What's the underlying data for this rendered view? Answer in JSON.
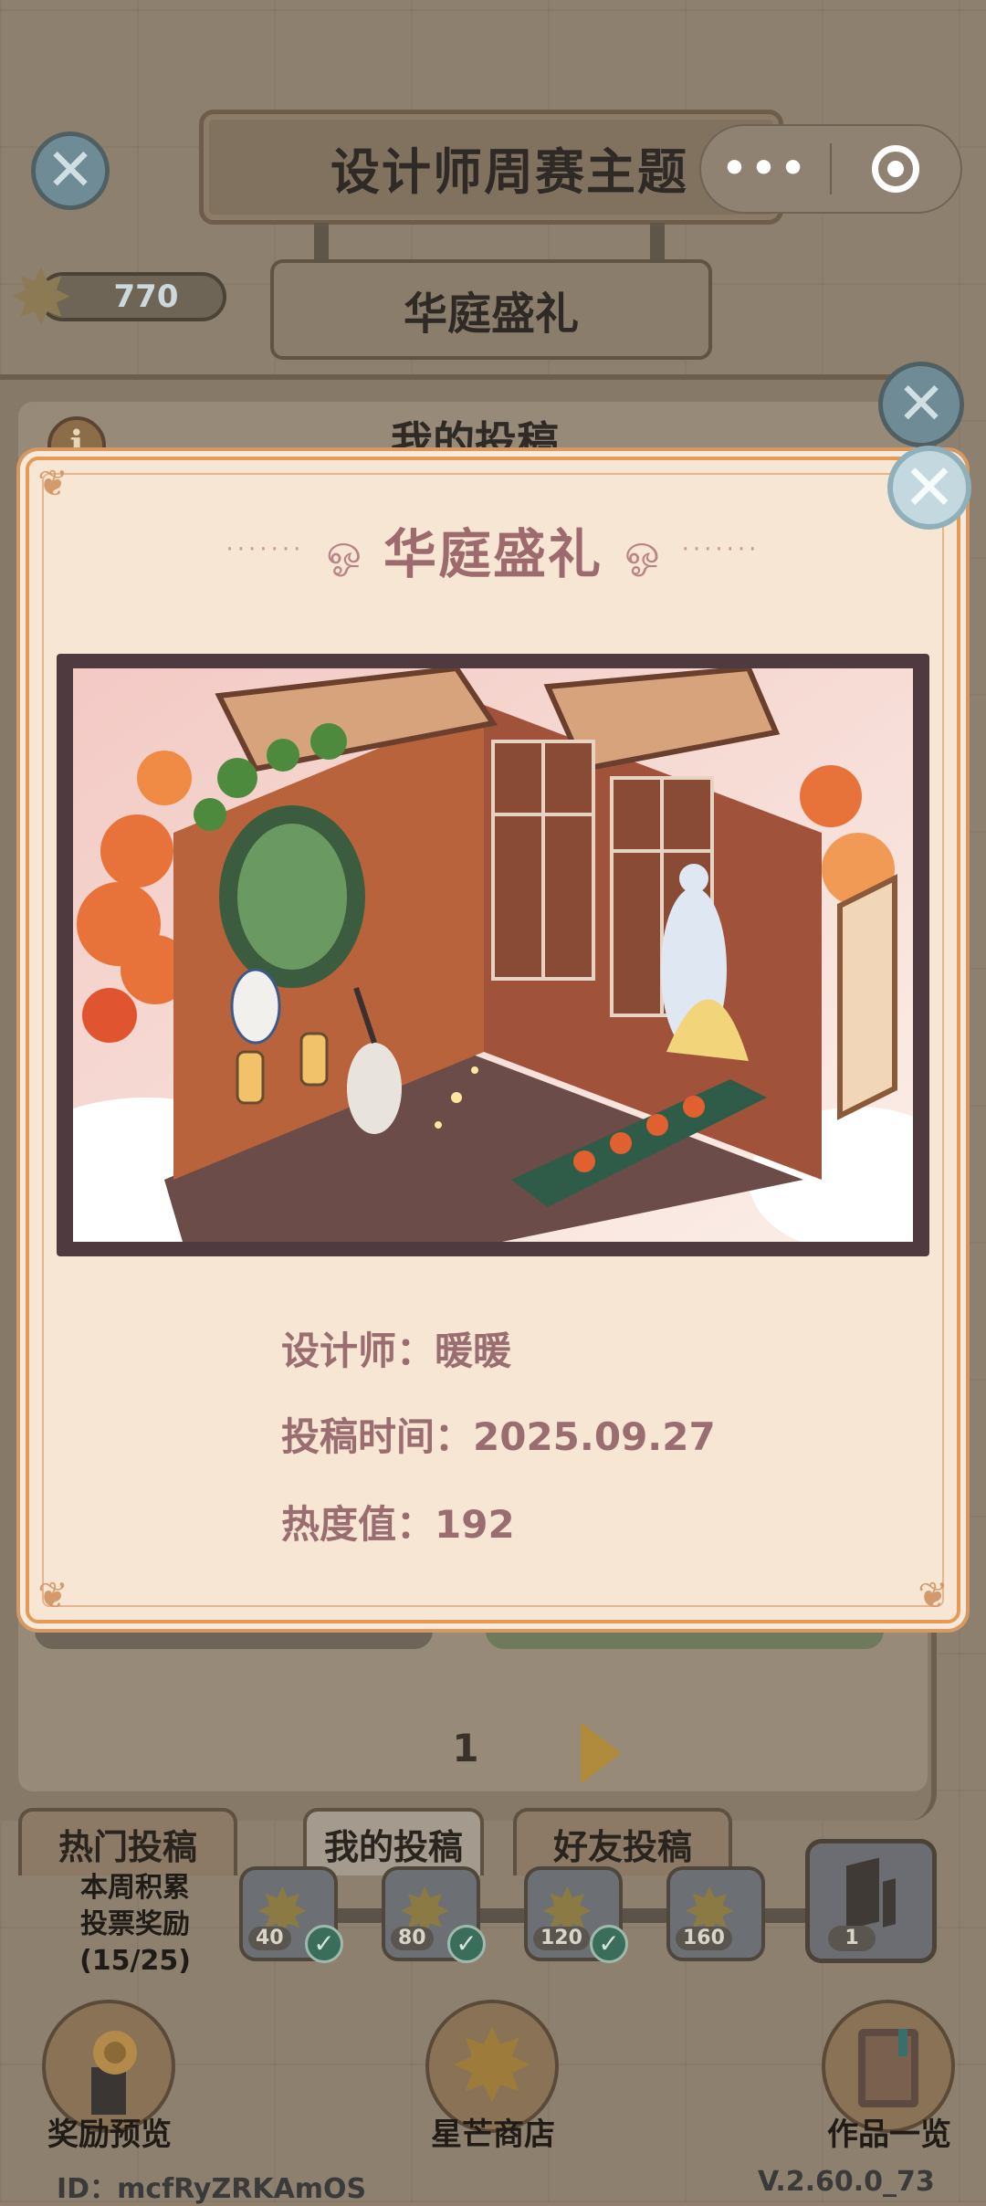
{
  "header": {
    "title": "设计师周赛主题",
    "subtitle": "华庭盛礼",
    "star_count": "770"
  },
  "capsule": {
    "more_label": "•••",
    "target_label": ""
  },
  "back_panel": {
    "heading": "我的投稿",
    "page_number": "1"
  },
  "modal": {
    "title": "华庭盛礼",
    "designer_label": "设计师：暖暖",
    "submit_time_label": "投稿时间：2025.09.27",
    "heat_label": "热度值：192",
    "close_icon": "close-icon"
  },
  "tabs": [
    {
      "label": "热门投稿",
      "active": false
    },
    {
      "label": "我的投稿",
      "active": true
    },
    {
      "label": "好友投稿",
      "active": false
    }
  ],
  "weekly": {
    "line1": "本周积累",
    "line2": "投票奖励",
    "line3": "(15/25)"
  },
  "rewards": [
    {
      "label": "40",
      "claimed": true
    },
    {
      "label": "80",
      "claimed": true
    },
    {
      "label": "120",
      "claimed": true
    },
    {
      "label": "160",
      "claimed": false
    }
  ],
  "big_reward_count": "1",
  "bottom_nav": {
    "left_label": "奖励预览",
    "center_label": "星芒商店",
    "right_label": "作品一览"
  },
  "footer": {
    "id_text": "ID：mcfRyZRKAmOS",
    "version": "V.2.60.0_73"
  },
  "colors": {
    "modal_bg": "#f7e6d4",
    "modal_border": "#e59a55",
    "modal_text": "#9a6d70"
  }
}
